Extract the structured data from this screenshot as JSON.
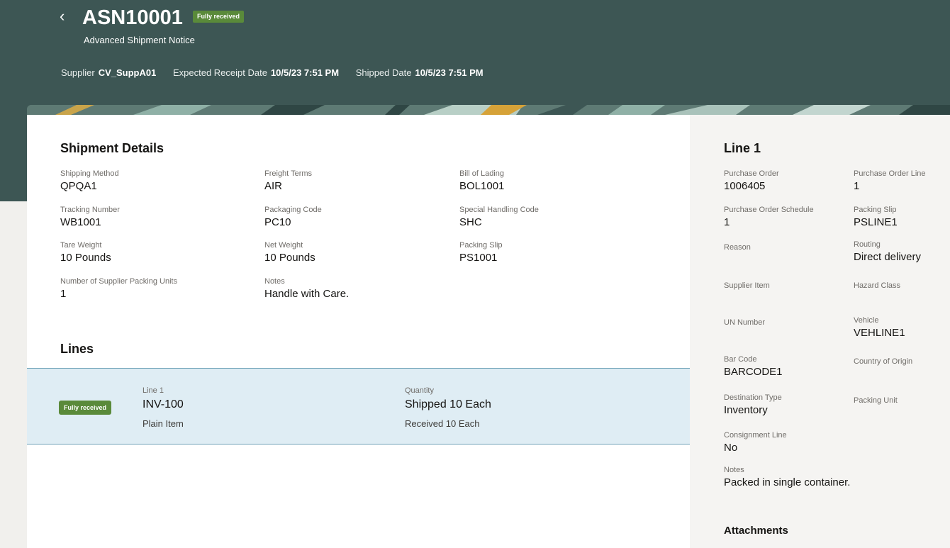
{
  "header": {
    "back_icon": "chevron-left-icon",
    "title": "ASN10001",
    "status_badge": "Fully received",
    "subtitle": "Advanced Shipment Notice",
    "supplier_label": "Supplier",
    "supplier_value": "CV_SuppA01",
    "expected_receipt_label": "Expected Receipt Date",
    "expected_receipt_value": "10/5/23 7:51 PM",
    "shipped_date_label": "Shipped Date",
    "shipped_date_value": "10/5/23 7:51 PM"
  },
  "colors": {
    "header_bg": "#3d5654",
    "badge_green": "#5a8a3a",
    "selected_row": "#dfedf4"
  },
  "shipment_details": {
    "title": "Shipment Details",
    "fields": [
      {
        "label": "Shipping Method",
        "value": "QPQA1"
      },
      {
        "label": "Freight Terms",
        "value": "AIR"
      },
      {
        "label": "Bill of Lading",
        "value": "BOL1001"
      },
      {
        "label": "Tracking Number",
        "value": "WB1001"
      },
      {
        "label": "Packaging Code",
        "value": "PC10"
      },
      {
        "label": "Special Handling Code",
        "value": "SHC"
      },
      {
        "label": "Tare Weight",
        "value": "10 Pounds"
      },
      {
        "label": "Net Weight",
        "value": "10 Pounds"
      },
      {
        "label": "Packing Slip",
        "value": "PS1001"
      },
      {
        "label": "Number of Supplier Packing Units",
        "value": "1"
      },
      {
        "label": "Notes",
        "value": "Handle with Care."
      }
    ]
  },
  "lines": {
    "title": "Lines",
    "rows": [
      {
        "status_badge": "Fully received",
        "line_label": "Line 1",
        "item": "INV-100",
        "item_desc": "Plain Item",
        "quantity_label": "Quantity",
        "shipped": "Shipped 10 Each",
        "received": "Received 10 Each"
      }
    ]
  },
  "line_detail": {
    "title": "Line 1",
    "fields": [
      {
        "label": "Purchase Order",
        "value": "1006405"
      },
      {
        "label": "Purchase Order Line",
        "value": "1"
      },
      {
        "label": "Purchase Order Schedule",
        "value": "1"
      },
      {
        "label": "Packing Slip",
        "value": "PSLINE1"
      },
      {
        "label": "Reason",
        "value": ""
      },
      {
        "label": "Routing",
        "value": "Direct delivery"
      },
      {
        "label": "Supplier Item",
        "value": ""
      },
      {
        "label": "Hazard Class",
        "value": ""
      },
      {
        "label": "UN Number",
        "value": ""
      },
      {
        "label": "Vehicle",
        "value": "VEHLINE1"
      },
      {
        "label": "Bar Code",
        "value": "BARCODE1"
      },
      {
        "label": "Country of Origin",
        "value": ""
      },
      {
        "label": "Destination Type",
        "value": "Inventory"
      },
      {
        "label": "Packing Unit",
        "value": ""
      },
      {
        "label": "Consignment Line",
        "value": "No"
      },
      {
        "label": "Notes",
        "value": "Packed in single container."
      }
    ],
    "attachments_title": "Attachments"
  }
}
